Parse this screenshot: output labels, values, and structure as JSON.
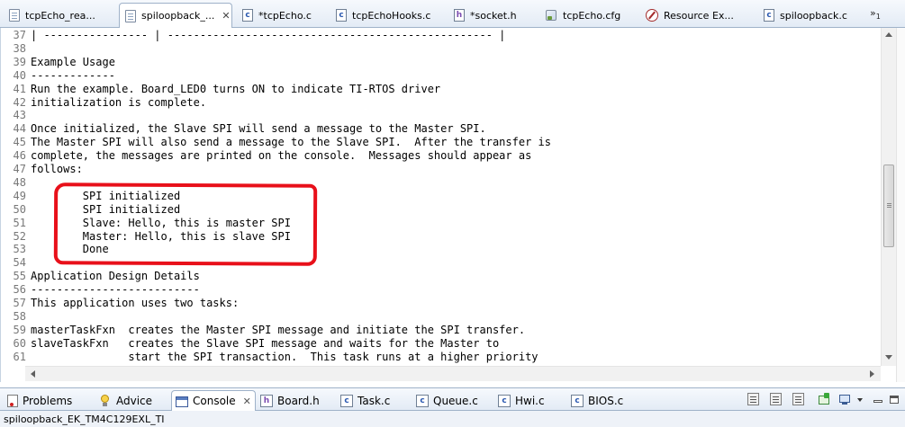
{
  "editor_tabs": [
    {
      "label": "tcpEcho_rea...",
      "icon": "text-file-icon",
      "active": false
    },
    {
      "label": "spiloopback_...",
      "icon": "text-file-icon",
      "active": true,
      "close": "✕"
    },
    {
      "label": "*tcpEcho.c",
      "icon": "c-file-icon",
      "active": false
    },
    {
      "label": "tcpEchoHooks.c",
      "icon": "c-file-icon",
      "active": false
    },
    {
      "label": "*socket.h",
      "icon": "h-file-icon",
      "active": false
    },
    {
      "label": "tcpEcho.cfg",
      "icon": "cfg-file-icon",
      "active": false
    },
    {
      "label": "Resource Ex...",
      "icon": "resource-explorer-icon",
      "active": false
    },
    {
      "label": "spiloopback.c",
      "icon": "c-file-icon",
      "active": false
    }
  ],
  "tab_overflow": {
    "symbol": "»",
    "count": "1"
  },
  "lines": [
    {
      "n": "37",
      "t": "| ---------------- | -------------------------------------------------- |"
    },
    {
      "n": "38",
      "t": ""
    },
    {
      "n": "39",
      "t": "Example Usage"
    },
    {
      "n": "40",
      "t": "-------------"
    },
    {
      "n": "41",
      "t": "Run the example. Board_LED0 turns ON to indicate TI-RTOS driver"
    },
    {
      "n": "42",
      "t": "initialization is complete."
    },
    {
      "n": "43",
      "t": ""
    },
    {
      "n": "44",
      "t": "Once initialized, the Slave SPI will send a message to the Master SPI."
    },
    {
      "n": "45",
      "t": "The Master SPI will also send a message to the Slave SPI.  After the transfer is"
    },
    {
      "n": "46",
      "t": "complete, the messages are printed on the console.  Messages should appear as"
    },
    {
      "n": "47",
      "t": "follows:"
    },
    {
      "n": "48",
      "t": ""
    },
    {
      "n": "49",
      "t": "        SPI initialized"
    },
    {
      "n": "50",
      "t": "        SPI initialized"
    },
    {
      "n": "51",
      "t": "        Slave: Hello, this is master SPI"
    },
    {
      "n": "52",
      "t": "        Master: Hello, this is slave SPI"
    },
    {
      "n": "53",
      "t": "        Done"
    },
    {
      "n": "54",
      "t": ""
    },
    {
      "n": "55",
      "t": "Application Design Details"
    },
    {
      "n": "56",
      "t": "--------------------------"
    },
    {
      "n": "57",
      "t": "This application uses two tasks:"
    },
    {
      "n": "58",
      "t": ""
    },
    {
      "n": "59",
      "t": "masterTaskFxn  creates the Master SPI message and initiate the SPI transfer."
    },
    {
      "n": "60",
      "t": "slaveTaskFxn   creates the Slave SPI message and waits for the Master to"
    },
    {
      "n": "61",
      "t": "               start the SPI transaction.  This task runs at a higher priority"
    }
  ],
  "bottom_tabs": [
    {
      "label": "Problems",
      "icon": "problems-icon",
      "active": false
    },
    {
      "label": "Advice",
      "icon": "lightbulb-icon",
      "active": false
    },
    {
      "label": "Console",
      "icon": "console-icon",
      "active": true,
      "close": "✕"
    },
    {
      "label": "Board.h",
      "icon": "h-file-icon",
      "active": false
    },
    {
      "label": "Task.c",
      "icon": "c-file-icon",
      "active": false
    },
    {
      "label": "Queue.c",
      "icon": "c-file-icon",
      "active": false
    },
    {
      "label": "Hwi.c",
      "icon": "c-file-icon",
      "active": false
    },
    {
      "label": "BIOS.c",
      "icon": "c-file-icon",
      "active": false
    }
  ],
  "status": {
    "project": "spiloopback_EK_TM4C129EXL_TI"
  },
  "colors": {
    "highlight_box": "#e8101a",
    "line_number": "#787878"
  }
}
